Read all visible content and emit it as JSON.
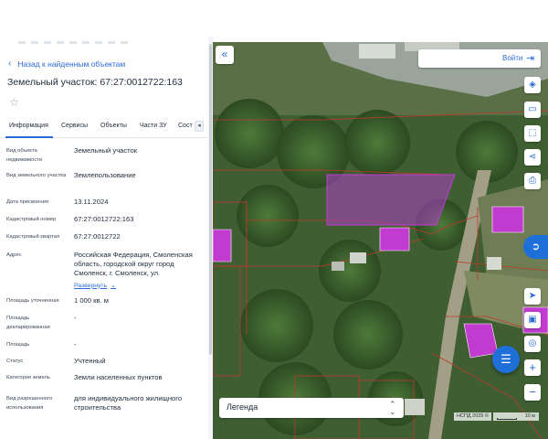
{
  "panel": {
    "back_link": "Назад к найденным объектам",
    "title": "Земельный участок: 67:27:0012722:163",
    "tabs": [
      "Информация",
      "Сервисы",
      "Объекты",
      "Части ЗУ",
      "Сост"
    ],
    "active_tab": "Информация",
    "fields": [
      {
        "label": "Вид объекта недвижимости",
        "value": "Земельный участок"
      },
      {
        "label": "Вид земельного участка",
        "value": "Землепользование"
      },
      {
        "label": "Дата присвоения",
        "value": "13.11.2024"
      },
      {
        "label": "Кадастровый номер",
        "value": "67:27:0012722:163"
      },
      {
        "label": "Кадастровый квартал",
        "value": "67:27:0012722"
      },
      {
        "label": "Адрес",
        "value": "Российская Федерация, Смоленская область, городской округ город Смоленск, г. Смоленск, ул."
      },
      {
        "label": "Площадь уточненная",
        "value": "1 000 кв. м"
      },
      {
        "label": "Площадь декларированная",
        "value": "-"
      },
      {
        "label": "Площадь",
        "value": "-"
      },
      {
        "label": "Статус",
        "value": "Учтенный"
      },
      {
        "label": "Категория земель",
        "value": "Земли населенных пунктов"
      },
      {
        "label": "Вид разрешенного использования",
        "value": "для индивидуального жилищного строительства"
      }
    ],
    "expand_link": "Развернуть"
  },
  "map": {
    "login_label": "Войти",
    "legend_label": "Легенда",
    "attribution": "НСПД 2025 ©",
    "scale_label": "10 м",
    "icons": {
      "collapse": "double-chevron-left-icon",
      "login": "login-icon",
      "layers": "layers-icon",
      "ruler": "ruler-icon",
      "select": "area-select-icon",
      "share": "share-icon",
      "print": "print-icon",
      "gosuslugi": "gosuslugi-logo-icon",
      "locate": "navigation-arrow-icon",
      "fullscreen": "fullscreen-icon",
      "geo": "geolocation-icon",
      "zoom_in": "plus-icon",
      "zoom_out": "minus-icon",
      "list": "list-menu-icon",
      "legend_toggle": "updown-chevron-icon"
    },
    "colors": {
      "accent": "#2c6bd6",
      "selected_parcel": "#b03cc8",
      "building_marker": "#c13bd0",
      "parcel_border": "#c0392b"
    }
  }
}
